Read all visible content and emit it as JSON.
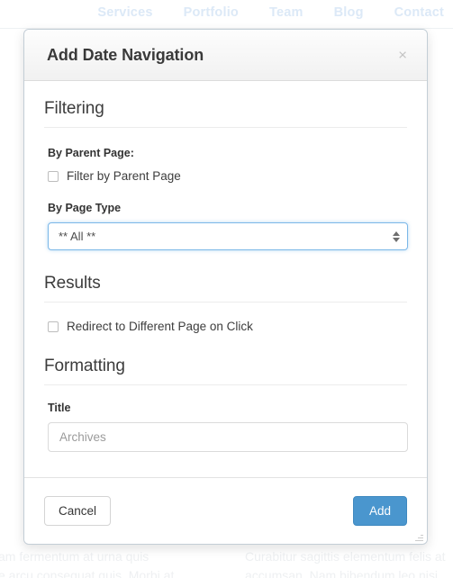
{
  "background": {
    "nav_items": [
      {
        "label": "Services"
      },
      {
        "label": "Portfolio"
      },
      {
        "label": "Team"
      },
      {
        "label": "Blog"
      },
      {
        "label": "Contact"
      }
    ],
    "text_blocks": [
      {
        "line1": "ullam fermentum at urna quis",
        "line2": "stie arcu consequat quis. Morbi at"
      },
      {
        "line1": "Curabitur sagittis elementum felis at",
        "line2": "accumsan. Nam bibendum leo nisi"
      }
    ]
  },
  "modal": {
    "title": "Add Date Navigation",
    "close_label": "×",
    "sections": {
      "filtering": {
        "heading": "Filtering",
        "parent_page_label": "By Parent Page:",
        "filter_checkbox_label": "Filter by Parent Page",
        "page_type_label": "By Page Type",
        "page_type_value": "** All **"
      },
      "results": {
        "heading": "Results",
        "redirect_checkbox_label": "Redirect to Different Page on Click"
      },
      "formatting": {
        "heading": "Formatting",
        "title_label": "Title",
        "title_placeholder": "Archives",
        "title_value": "Archives"
      }
    },
    "footer": {
      "cancel_label": "Cancel",
      "add_label": "Add"
    },
    "colors": {
      "accent_button": "#4a96ce",
      "focus_border": "#7cb8e8",
      "nav_link": "#dce9f7"
    }
  }
}
